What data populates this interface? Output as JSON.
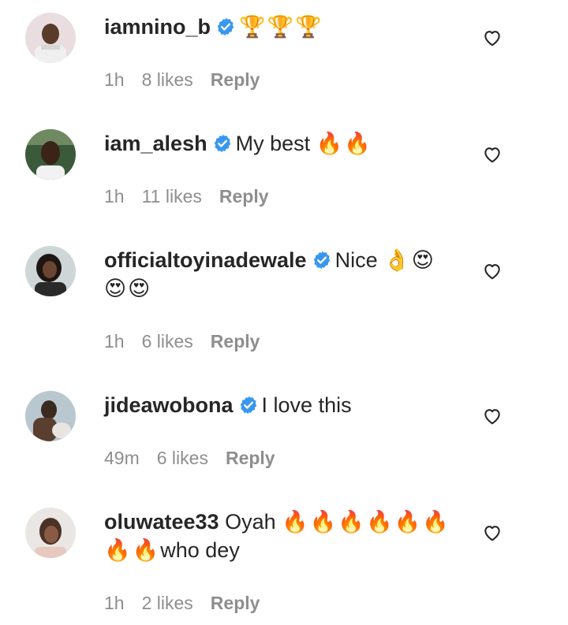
{
  "comments": [
    {
      "username": "iamnino_b",
      "verified": true,
      "text_line1": "",
      "emoji_line1": "🏆🏆🏆",
      "text_line2": "",
      "time": "1h",
      "likes": "8 likes",
      "reply": "Reply",
      "avatar": "avatar-boy-photo"
    },
    {
      "username": "iam_alesh",
      "verified": true,
      "text_line1": "My best ",
      "emoji_line1": "🔥🔥",
      "text_line2": "",
      "time": "1h",
      "likes": "11 likes",
      "reply": "Reply",
      "avatar": "avatar-man-photo"
    },
    {
      "username": "officialtoyinadewale",
      "verified": true,
      "text_line1": "Nice ",
      "emoji_line1": "👌😍",
      "emoji_line2": "😍😍",
      "time": "1h",
      "likes": "6 likes",
      "reply": "Reply",
      "avatar": "avatar-woman-photo"
    },
    {
      "username": "jideawobona",
      "verified": true,
      "text_line1": "I love this",
      "emoji_line1": "",
      "time": "49m",
      "likes": "6 likes",
      "reply": "Reply",
      "avatar": "avatar-man-pot-photo"
    },
    {
      "username": "oluwatee33",
      "verified": false,
      "text_line1": "Oyah ",
      "emoji_line1": "🔥🔥🔥🔥🔥🔥",
      "emoji_line2": "🔥🔥",
      "text_line2": "who dey",
      "time": "1h",
      "likes": "2 likes",
      "reply": "Reply",
      "avatar": "avatar-woman2-photo"
    }
  ],
  "icons": {
    "like": "heart-outline-icon",
    "verified": "verified-badge-icon"
  },
  "colors": {
    "verified": "#3897f0",
    "meta": "#8e8e8e",
    "text": "#262626"
  }
}
